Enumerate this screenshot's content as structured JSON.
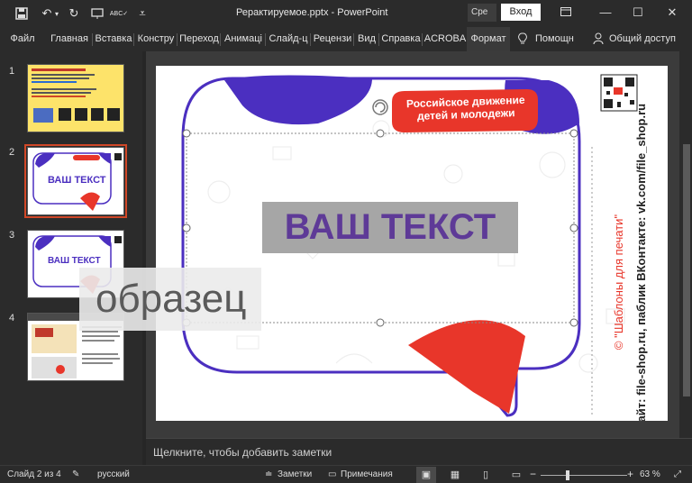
{
  "titlebar": {
    "doc_title": "Рерактируемое.pptx  -  PowerPoint",
    "search_label": "Сре",
    "login_label": "Вход"
  },
  "ribbon": {
    "tabs": [
      "Файл",
      "Главная",
      "Вставка",
      "Констру",
      "Переход",
      "Анимаці",
      "Слайд-ц",
      "Рецензи",
      "Вид",
      "Справка",
      "ACROBA",
      "Формат"
    ],
    "help_label": "Помощн",
    "share_label": "Общий доступ"
  },
  "thumbnails": {
    "items": [
      {
        "number": "1"
      },
      {
        "number": "2"
      },
      {
        "number": "3"
      },
      {
        "number": "4"
      }
    ],
    "thumb2_text": "ВАШ ТЕКСТ",
    "thumb3_text": "ВАШ ТЕКСТ"
  },
  "watermark_text": "образец",
  "slide": {
    "main_text": "ВАШ ТЕКСТ",
    "banner_line1": "Российское движение",
    "banner_line2": "детей и молодежи",
    "side_line1": "© \"Шаблоны для печати\"",
    "side_line2": "Сайт: file-shop.ru, паблик ВКонтакте: vk.com/file_shop.ru"
  },
  "notes_placeholder": "Щелкните, чтобы добавить заметки",
  "statusbar": {
    "slide_counter": "Слайд 2 из 4",
    "language": "русский",
    "notes_label": "Заметки",
    "comments_label": "Примечания",
    "zoom_value": "63 %"
  },
  "colors": {
    "accent_red": "#e8362a",
    "accent_purple": "#4b2fc0",
    "text_purple": "#5e3a97",
    "selection_orange": "#d04727"
  }
}
